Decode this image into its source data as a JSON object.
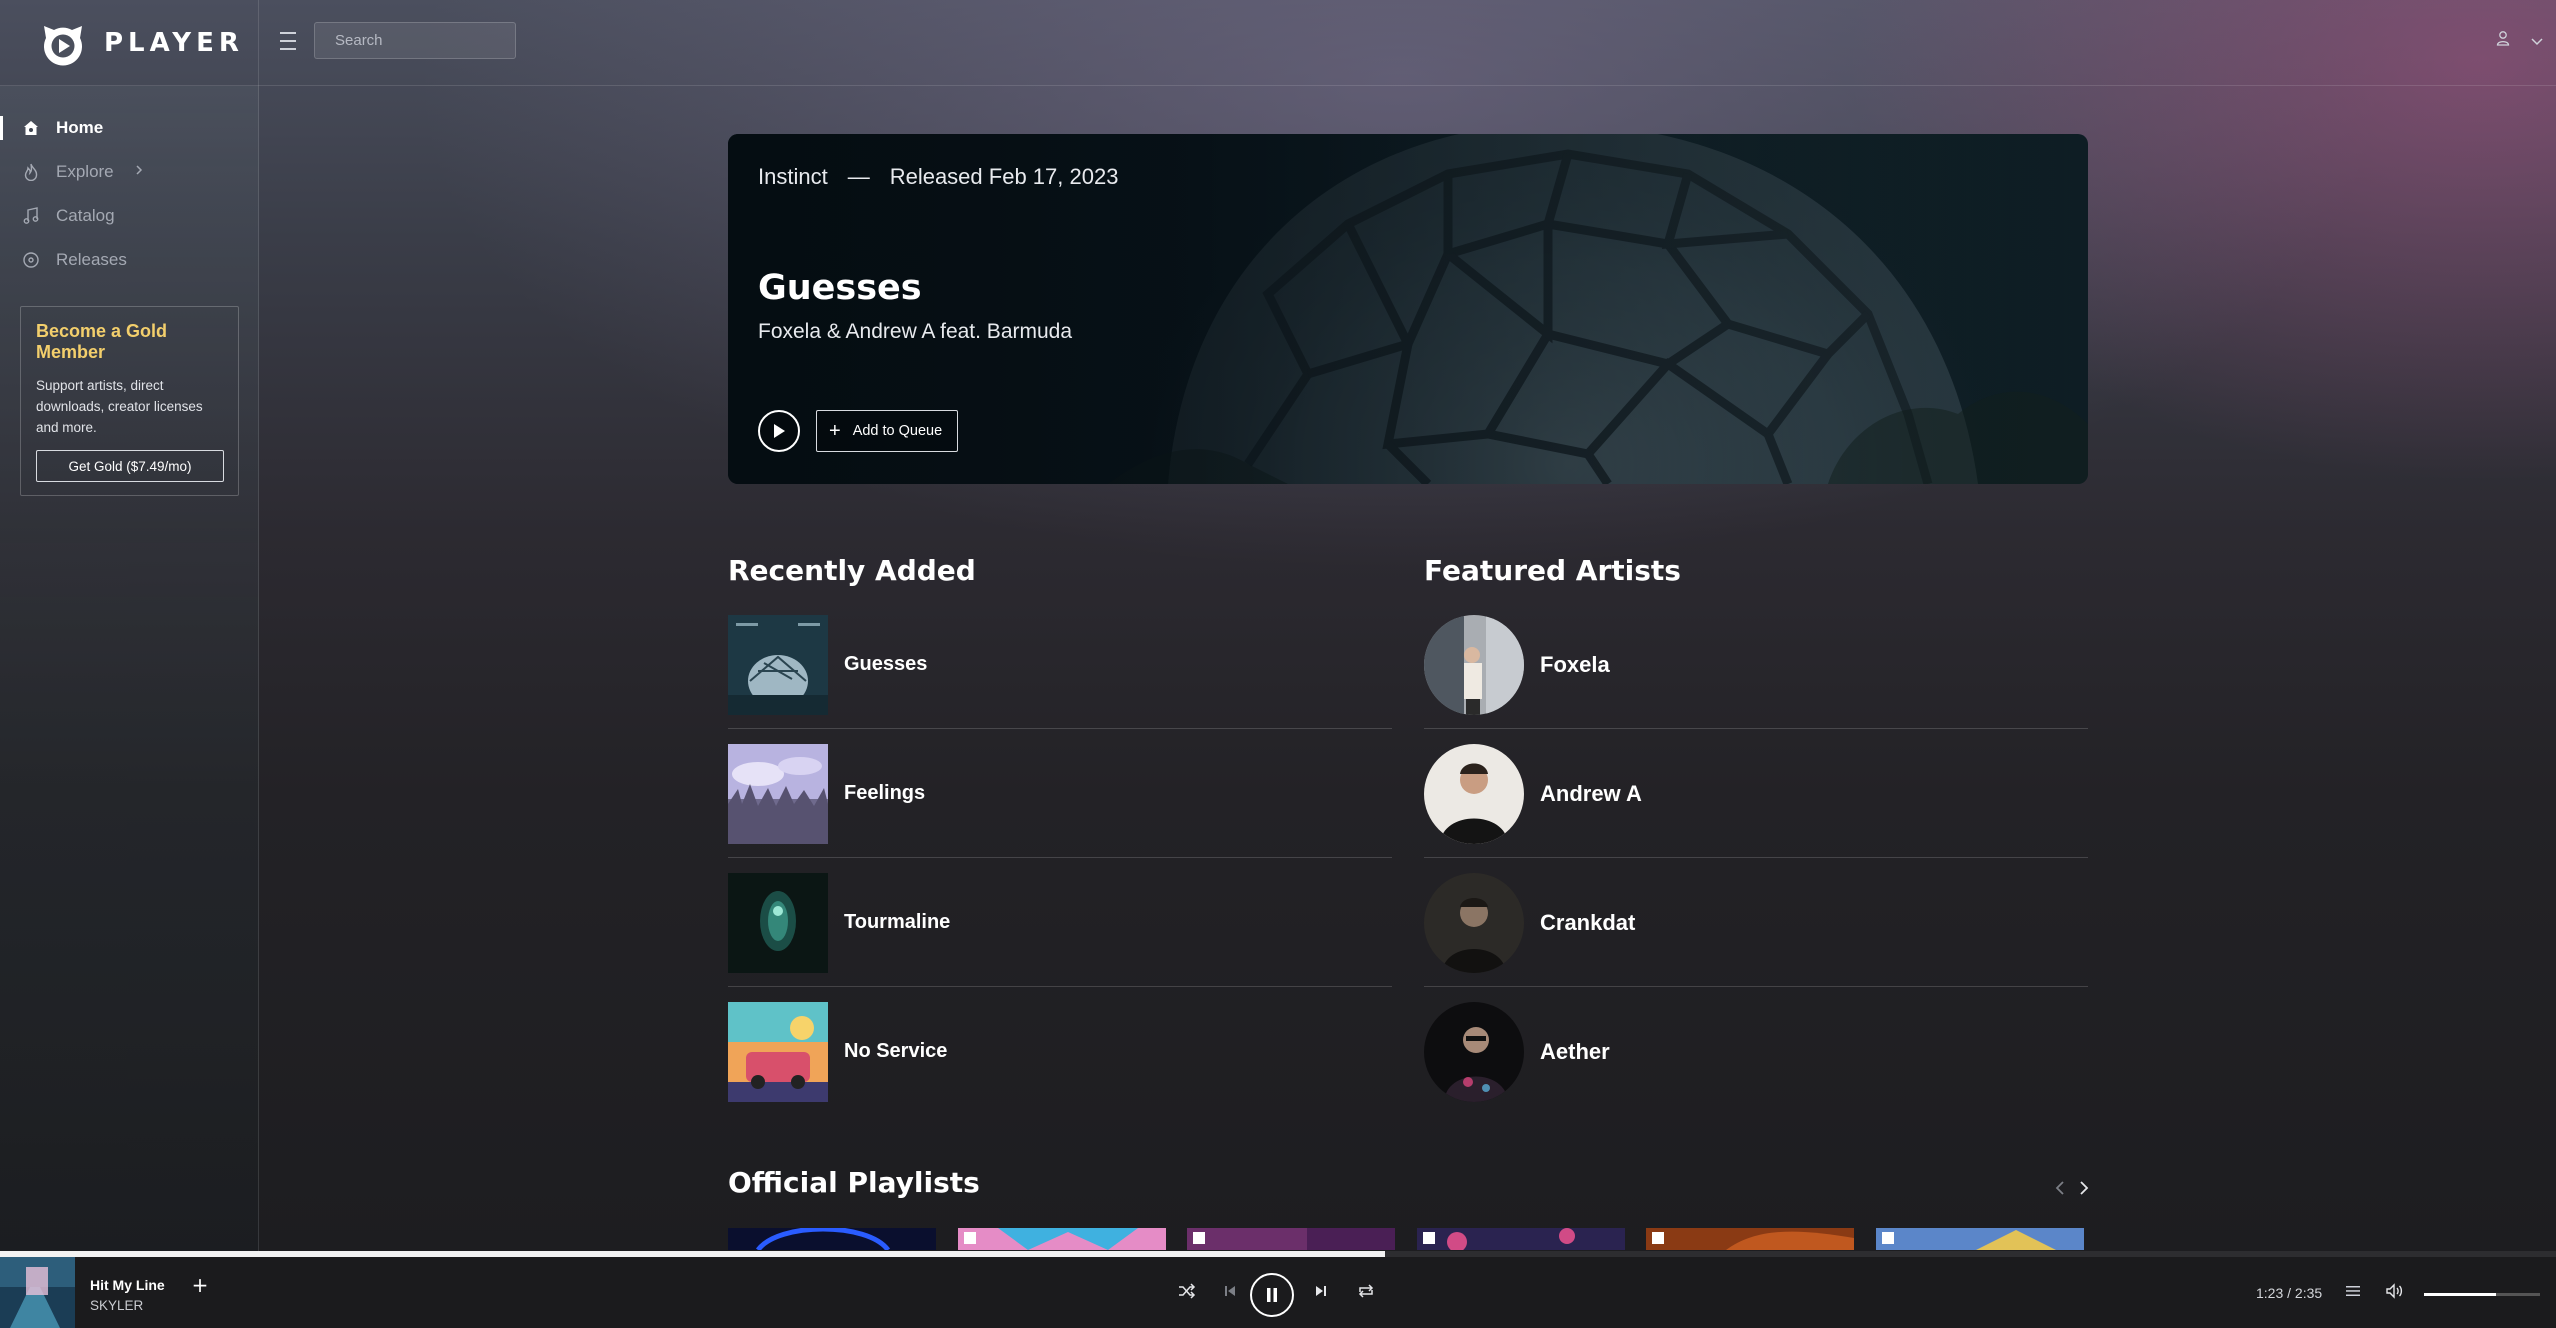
{
  "app": {
    "brand": "PLAYER"
  },
  "search": {
    "placeholder": "Search"
  },
  "sidebar": {
    "items": [
      {
        "label": "Home",
        "icon": "home-icon",
        "active": true
      },
      {
        "label": "Explore",
        "icon": "flame-icon",
        "has_submenu": true
      },
      {
        "label": "Catalog",
        "icon": "music-note-icon"
      },
      {
        "label": "Releases",
        "icon": "disc-icon"
      }
    ],
    "gold": {
      "title": "Become a Gold Member",
      "text": "Support artists, direct downloads, creator licenses and more.",
      "button": "Get Gold ($7.49/mo)",
      "accent": "#f3cf6c"
    }
  },
  "hero": {
    "label": "Instinct",
    "separator": "—",
    "released": "Released Feb 17, 2023",
    "title": "Guesses",
    "artists": "Foxela & Andrew A feat. Barmuda",
    "queue_label": "Add to Queue"
  },
  "recently_added": {
    "title": "Recently Added",
    "items": [
      {
        "name": "Guesses"
      },
      {
        "name": "Feelings"
      },
      {
        "name": "Tourmaline"
      },
      {
        "name": "No Service"
      }
    ]
  },
  "featured_artists": {
    "title": "Featured Artists",
    "items": [
      {
        "name": "Foxela"
      },
      {
        "name": "Andrew A"
      },
      {
        "name": "Crankdat"
      },
      {
        "name": "Aether"
      }
    ]
  },
  "playlists": {
    "title": "Official Playlists"
  },
  "player": {
    "track": "Hit My Line",
    "artist": "SKYLER",
    "time": "1:23 / 2:35",
    "progress": 0.542,
    "volume": 0.62
  }
}
